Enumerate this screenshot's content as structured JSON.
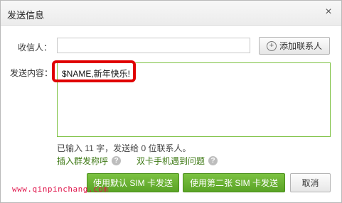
{
  "dialog": {
    "title": "发送信息",
    "close_symbol": "×"
  },
  "recipient": {
    "label": "收信人：",
    "value": "",
    "add_contact_label": "添加联系人",
    "add_icon_symbol": "+"
  },
  "content": {
    "label": "发送内容：",
    "value": "$NAME,新年快乐!"
  },
  "status": {
    "count_text": "已输入 11 字，发送给 0 位联系人。"
  },
  "links": {
    "insert_title_label": "插入群发称呼",
    "dual_sim_help_label": "双卡手机遇到问题",
    "help_symbol": "?"
  },
  "buttons": {
    "send_default_sim": "使用默认 SIM 卡发送",
    "send_second_sim": "使用第二张 SIM 卡发送",
    "cancel": "取消"
  },
  "watermark": "www.qinpinchang.com",
  "colors": {
    "accent_green": "#5aa326",
    "highlight_red": "#e00000",
    "link_green": "#3f7a16"
  }
}
